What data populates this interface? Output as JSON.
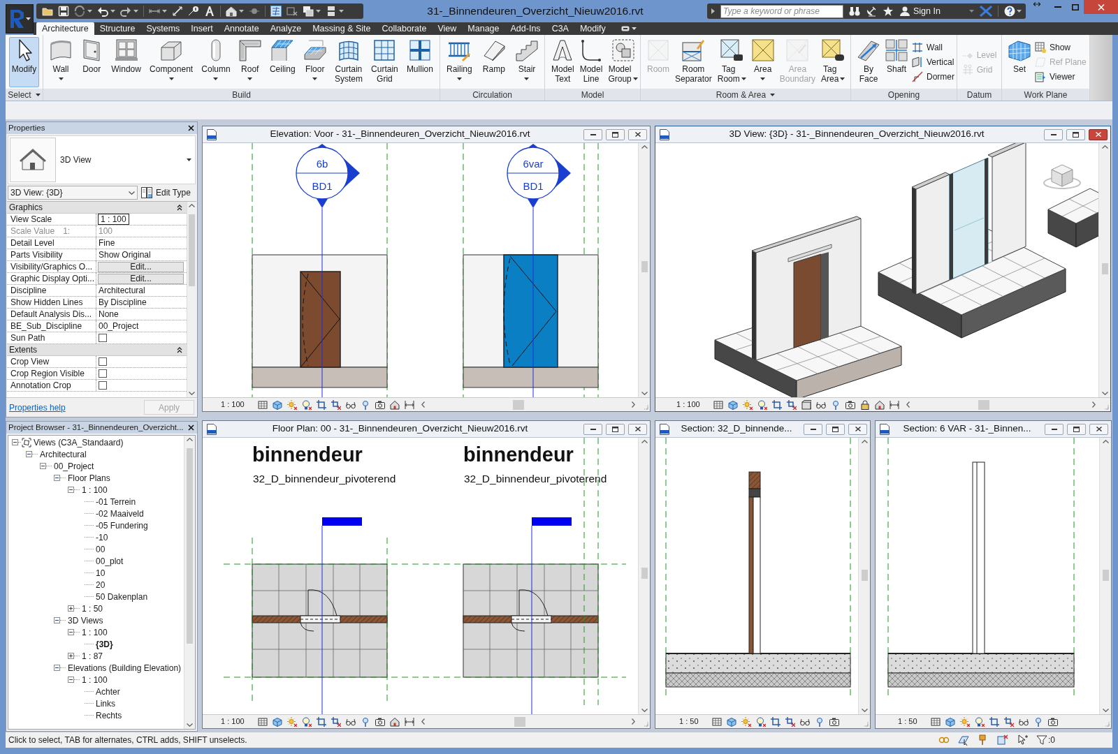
{
  "window": {
    "title": "31-_Binnendeuren_Overzicht_Nieuw2016.rvt"
  },
  "help_bar": {
    "search": {
      "placeholder": "Type a keyword or phrase"
    },
    "sign_in": "Sign In"
  },
  "ribbon": {
    "tabs": [
      {
        "label": "Architecture",
        "selected": true
      },
      {
        "label": "Structure",
        "selected": false
      },
      {
        "label": "Systems",
        "selected": false
      },
      {
        "label": "Insert",
        "selected": false
      },
      {
        "label": "Annotate",
        "selected": false
      },
      {
        "label": "Analyze",
        "selected": false
      },
      {
        "label": "Massing & Site",
        "selected": false
      },
      {
        "label": "Collaborate",
        "selected": false
      },
      {
        "label": "View",
        "selected": false
      },
      {
        "label": "Manage",
        "selected": false
      },
      {
        "label": "Add-Ins",
        "selected": false
      },
      {
        "label": "C3A",
        "selected": false
      },
      {
        "label": "Modify",
        "selected": false
      }
    ],
    "panels": [
      {
        "title": "Select",
        "menu": true,
        "tools": [
          {
            "kind": "large",
            "label": "Modify",
            "dropdown": false,
            "disabled": false,
            "active": true
          }
        ]
      },
      {
        "title": "Build",
        "menu": false,
        "tools": [
          {
            "kind": "large",
            "label": "Wall",
            "dropdown": true,
            "disabled": false
          },
          {
            "kind": "large",
            "label": "Door",
            "dropdown": false,
            "disabled": false
          },
          {
            "kind": "large",
            "label": "Window",
            "dropdown": false,
            "disabled": false
          },
          {
            "kind": "large",
            "label": "Component",
            "dropdown": true,
            "disabled": false
          },
          {
            "kind": "large",
            "label": "Column",
            "dropdown": true,
            "disabled": false
          },
          {
            "kind": "large",
            "label": "Roof",
            "dropdown": true,
            "disabled": false
          },
          {
            "kind": "large",
            "label": "Ceiling",
            "dropdown": false,
            "disabled": false
          },
          {
            "kind": "large",
            "label": "Floor",
            "dropdown": true,
            "disabled": false
          },
          {
            "kind": "large",
            "label": "Curtain System",
            "dropdown": false,
            "disabled": false
          },
          {
            "kind": "large",
            "label": "Curtain Grid",
            "dropdown": false,
            "disabled": false
          },
          {
            "kind": "large",
            "label": "Mullion",
            "dropdown": false,
            "disabled": false
          }
        ]
      },
      {
        "title": "Circulation",
        "menu": false,
        "tools": [
          {
            "kind": "large",
            "label": "Railing",
            "dropdown": true,
            "disabled": false
          },
          {
            "kind": "large",
            "label": "Ramp",
            "dropdown": false,
            "disabled": false
          },
          {
            "kind": "large",
            "label": "Stair",
            "dropdown": true,
            "disabled": false
          }
        ]
      },
      {
        "title": "Model",
        "menu": false,
        "tools": [
          {
            "kind": "large",
            "label": "Model Text",
            "dropdown": false,
            "disabled": false
          },
          {
            "kind": "large",
            "label": "Model Line",
            "dropdown": false,
            "disabled": false
          },
          {
            "kind": "large",
            "label": "Model Group",
            "dropdown": true,
            "disabled": false
          }
        ]
      },
      {
        "title": "Room & Area",
        "menu": true,
        "tools": [
          {
            "kind": "large",
            "label": "Room",
            "dropdown": false,
            "disabled": true
          },
          {
            "kind": "large",
            "label": "Room Separator",
            "dropdown": false,
            "disabled": false
          },
          {
            "kind": "large",
            "label": "Tag Room",
            "dropdown": true,
            "disabled": false
          },
          {
            "kind": "large",
            "label": "Area",
            "dropdown": true,
            "disabled": false
          },
          {
            "kind": "large",
            "label": "Area Boundary",
            "dropdown": false,
            "disabled": true
          },
          {
            "kind": "large",
            "label": "Tag Area",
            "dropdown": true,
            "disabled": false
          }
        ]
      },
      {
        "title": "Opening",
        "menu": false,
        "tools": [
          {
            "kind": "large",
            "label": "By Face",
            "dropdown": false,
            "disabled": false
          },
          {
            "kind": "large",
            "label": "Shaft",
            "dropdown": false,
            "disabled": false
          },
          {
            "kind": "small",
            "label": "Wall",
            "dropdown": false,
            "disabled": false
          },
          {
            "kind": "small",
            "label": "Vertical",
            "dropdown": false,
            "disabled": false
          },
          {
            "kind": "small",
            "label": "Dormer",
            "dropdown": false,
            "disabled": false
          }
        ]
      },
      {
        "title": "Datum",
        "menu": false,
        "tools": [
          {
            "kind": "small",
            "label": "Level",
            "dropdown": false,
            "disabled": true
          },
          {
            "kind": "small",
            "label": "Grid",
            "dropdown": false,
            "disabled": true
          }
        ]
      },
      {
        "title": "Work Plane",
        "menu": false,
        "tools": [
          {
            "kind": "large",
            "label": "Set",
            "dropdown": false,
            "disabled": false
          },
          {
            "kind": "small",
            "label": "Show",
            "dropdown": false,
            "disabled": false
          },
          {
            "kind": "small",
            "label": "Ref Plane",
            "dropdown": false,
            "disabled": true
          },
          {
            "kind": "small",
            "label": "Viewer",
            "dropdown": false,
            "disabled": false
          }
        ]
      }
    ]
  },
  "properties": {
    "title": "Properties",
    "type_name": "3D View",
    "instance": "3D View: {3D}",
    "edit_type": "Edit Type",
    "groups": [
      {
        "name": "Graphics",
        "expanded": true,
        "rows": [
          {
            "kind": "field",
            "label": "View Scale",
            "value": "1 : 100",
            "disabled": false
          },
          {
            "kind": "text",
            "label": "Scale Value",
            "label_suffix": "1:",
            "value": "100",
            "disabled": true
          },
          {
            "kind": "text",
            "label": "Detail Level",
            "value": "Fine",
            "disabled": false
          },
          {
            "kind": "text",
            "label": "Parts Visibility",
            "value": "Show Original",
            "disabled": false
          },
          {
            "kind": "button",
            "label": "Visibility/Graphics O...",
            "value": "Edit...",
            "disabled": false
          },
          {
            "kind": "button",
            "label": "Graphic Display Opti...",
            "value": "Edit...",
            "disabled": false
          },
          {
            "kind": "text",
            "label": "Discipline",
            "value": "Architectural",
            "disabled": false
          },
          {
            "kind": "text",
            "label": "Show Hidden Lines",
            "value": "By Discipline",
            "disabled": false
          },
          {
            "kind": "text",
            "label": "Default Analysis Dis...",
            "value": "None",
            "disabled": false
          },
          {
            "kind": "text",
            "label": "BE_Sub_Discipline",
            "value": "00_Project",
            "disabled": false
          },
          {
            "kind": "checkbox",
            "label": "Sun Path",
            "checked": false,
            "disabled": false
          }
        ]
      },
      {
        "name": "Extents",
        "expanded": true,
        "rows": [
          {
            "kind": "checkbox",
            "label": "Crop View",
            "checked": false,
            "disabled": false
          },
          {
            "kind": "checkbox",
            "label": "Crop Region Visible",
            "checked": false,
            "disabled": false
          },
          {
            "kind": "checkbox",
            "label": "Annotation Crop",
            "checked": false,
            "disabled": false
          }
        ]
      }
    ],
    "help_link": "Properties help",
    "apply": {
      "label": "Apply",
      "disabled": true
    }
  },
  "project_browser": {
    "title": "Project Browser - 31-_Binnendeuren_Overzicht...",
    "tree": [
      {
        "label": "Views (C3A_Standaard)",
        "expanded": true,
        "current": false,
        "children": [
          {
            "label": "Architectural",
            "expanded": true,
            "current": false,
            "children": [
              {
                "label": "00_Project",
                "expanded": true,
                "current": false,
                "children": [
                  {
                    "label": "Floor Plans",
                    "expanded": true,
                    "current": false,
                    "children": [
                      {
                        "label": "1 : 100",
                        "expanded": true,
                        "current": false,
                        "children": [
                          {
                            "label": "-01 Terrein",
                            "current": false
                          },
                          {
                            "label": "-02 Maaiveld",
                            "current": false
                          },
                          {
                            "label": "-05 Fundering",
                            "current": false
                          },
                          {
                            "label": "-10",
                            "current": false
                          },
                          {
                            "label": "00",
                            "current": false
                          },
                          {
                            "label": "00_plot",
                            "current": false
                          },
                          {
                            "label": "10",
                            "current": false
                          },
                          {
                            "label": "20",
                            "current": false
                          },
                          {
                            "label": "50 Dakenplan",
                            "current": false
                          }
                        ]
                      },
                      {
                        "label": "1 : 50",
                        "expanded": false,
                        "current": false
                      }
                    ]
                  },
                  {
                    "label": "3D Views",
                    "expanded": true,
                    "current": false,
                    "children": [
                      {
                        "label": "1 : 100",
                        "expanded": true,
                        "current": false,
                        "children": [
                          {
                            "label": "{3D}",
                            "current": true
                          }
                        ]
                      },
                      {
                        "label": "1 : 87",
                        "expanded": false,
                        "current": false
                      }
                    ]
                  },
                  {
                    "label": "Elevations (Building Elevation)",
                    "expanded": true,
                    "current": false,
                    "children": [
                      {
                        "label": "1 : 100",
                        "expanded": true,
                        "current": false,
                        "children": [
                          {
                            "label": "Achter",
                            "current": false
                          },
                          {
                            "label": "Links",
                            "current": false
                          },
                          {
                            "label": "Rechts",
                            "current": false
                          }
                        ]
                      }
                    ]
                  }
                ]
              }
            ]
          }
        ]
      }
    ]
  },
  "views": [
    {
      "kind": "elevation",
      "title": "Elevation: Voor - 31-_Binnendeuren_Overzicht_Nieuw2016.rvt",
      "active": false,
      "scale": "1 : 100",
      "tags": [
        {
          "number": "6b",
          "type": "BD1"
        },
        {
          "number": "6var",
          "type": "BD1"
        }
      ]
    },
    {
      "kind": "isometric",
      "title": "3D View: {3D} - 31-_Binnendeuren_Overzicht_Nieuw2016.rvt",
      "active": true,
      "scale": "1 : 100"
    },
    {
      "kind": "plan",
      "title": "Floor Plan: 00 - 31-_Binnendeuren_Overzicht_Nieuw2016.rvt",
      "active": false,
      "scale": "1 : 100",
      "labels": [
        {
          "name": "binnendeur",
          "type": "32_D_binnendeur_pivoterend"
        },
        {
          "name": "binnendeur",
          "type": "32_D_binnendeur_pivoterend"
        }
      ]
    },
    {
      "kind": "section",
      "title": "Section: 32_D_binnende...",
      "active": false,
      "scale": "1 : 50"
    },
    {
      "kind": "section",
      "title": "Section: 6 VAR - 31-_Binnen...",
      "active": false,
      "scale": "1 : 50"
    }
  ],
  "status_bar": {
    "message": "Click to select, TAB for alternates, CTRL adds, SHIFT unselects.",
    "filter_count": ":0"
  }
}
